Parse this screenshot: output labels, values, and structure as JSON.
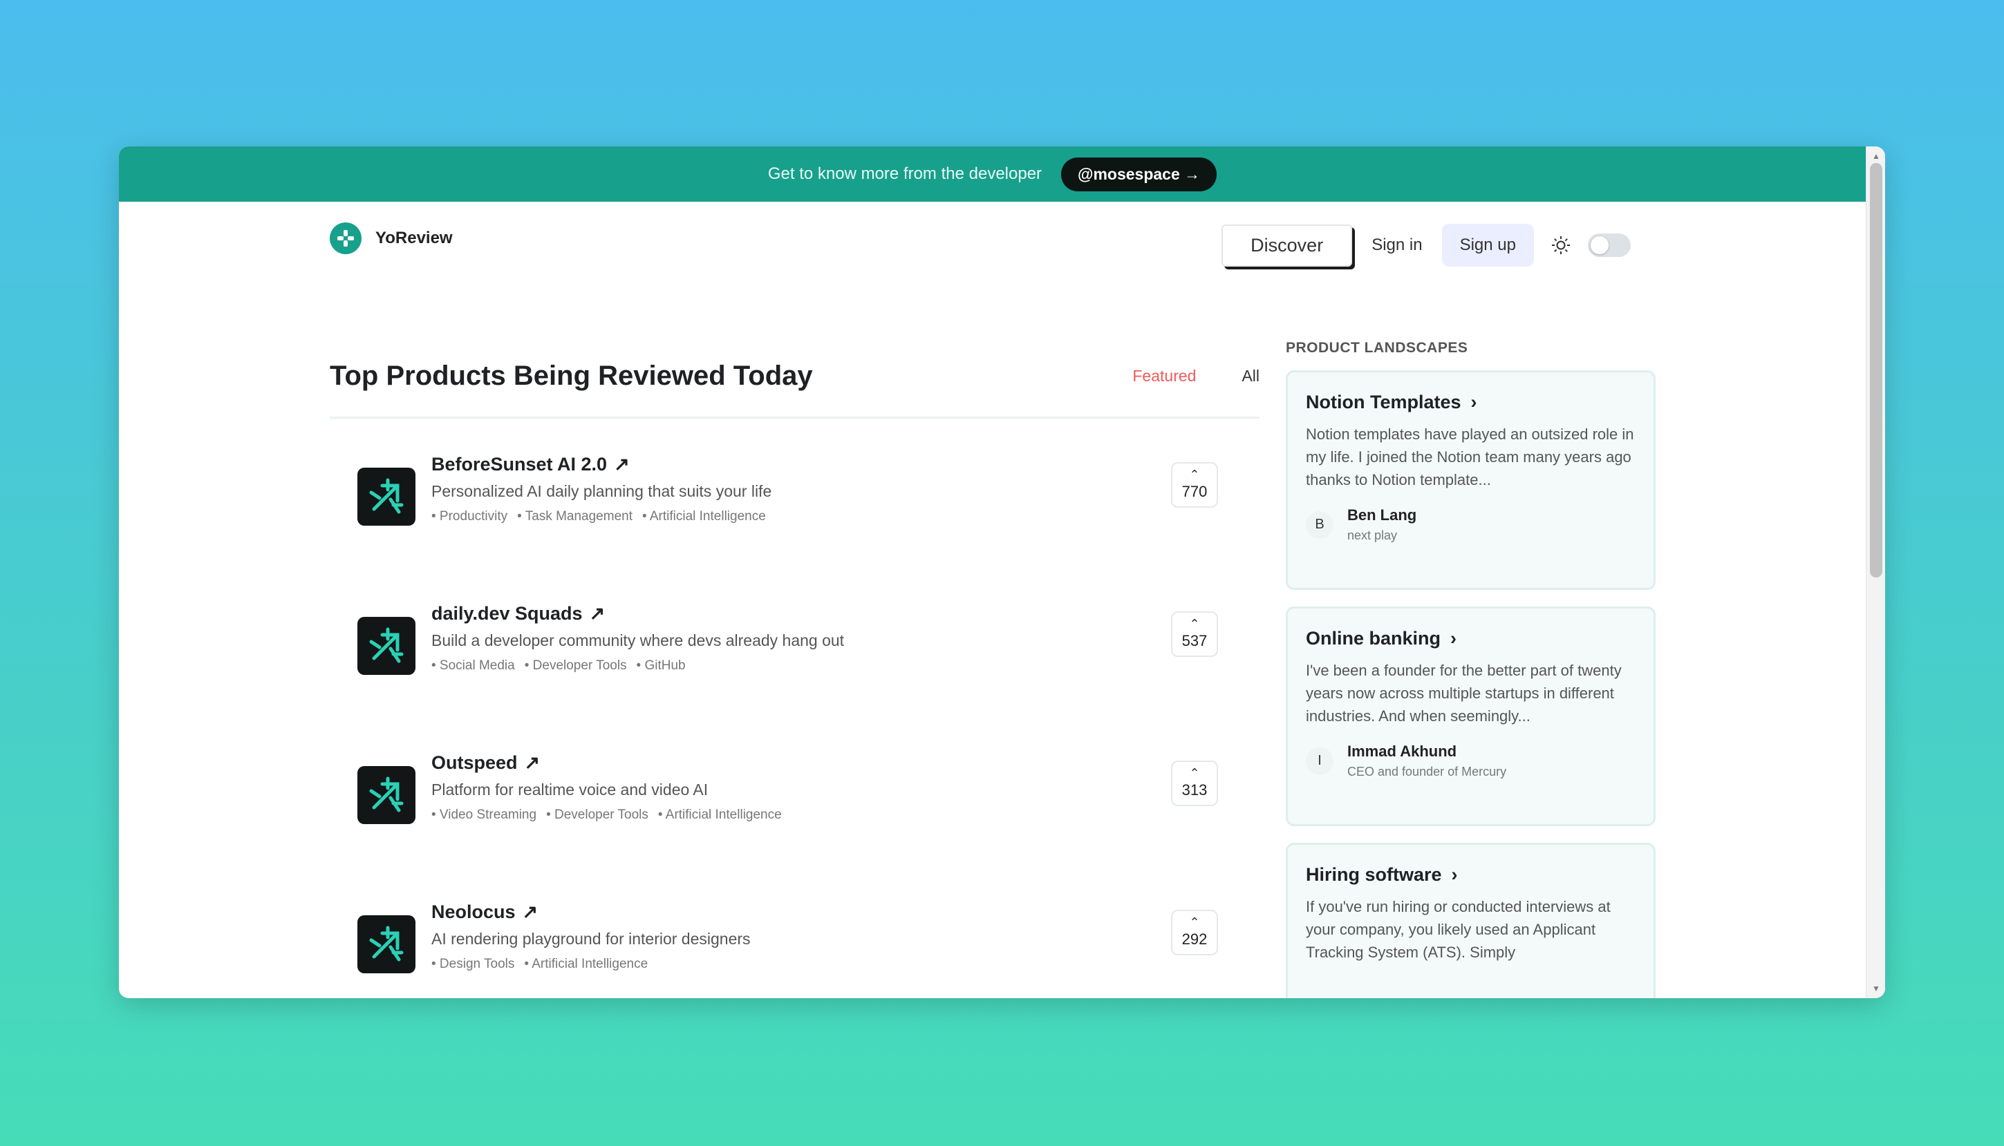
{
  "banner": {
    "text": "Get to know more from the developer",
    "pill_label": "@mosespace →"
  },
  "nav": {
    "brand": "YoReview",
    "discover_label": "Discover",
    "signin_label": "Sign in",
    "signup_label": "Sign up",
    "theme_toggle_on": false
  },
  "main": {
    "title": "Top Products Being Reviewed Today",
    "filters": [
      {
        "label": "Featured",
        "active": true
      },
      {
        "label": "All",
        "active": false
      }
    ],
    "products": [
      {
        "name": "BeforeSunset AI 2.0",
        "description": "Personalized AI daily planning that suits your life",
        "tags": [
          "• Productivity",
          "• Task Management",
          "• Artificial Intelligence"
        ],
        "votes": "770"
      },
      {
        "name": "daily.dev Squads",
        "description": "Build a developer community where devs already hang out",
        "tags": [
          "• Social Media",
          "• Developer Tools",
          "• GitHub"
        ],
        "votes": "537"
      },
      {
        "name": "Outspeed",
        "description": "Platform for realtime voice and video AI",
        "tags": [
          "• Video Streaming",
          "• Developer Tools",
          "• Artificial Intelligence"
        ],
        "votes": "313"
      },
      {
        "name": "Neolocus",
        "description": "AI rendering playground for interior designers",
        "tags": [
          "• Design Tools",
          "• Artificial Intelligence"
        ],
        "votes": "292"
      }
    ]
  },
  "sidebar": {
    "title": "PRODUCT LANDSCAPES",
    "landscapes": [
      {
        "title": "Notion Templates",
        "text": "Notion templates have played an outsized role in my life. I joined the Notion team many years ago thanks to Notion template...",
        "author_initial": "B",
        "author_name": "Ben Lang",
        "author_role": "next play"
      },
      {
        "title": "Online banking",
        "text": "I've been a founder for the better part of twenty years now across multiple startups in different industries. And when seemingly...",
        "author_initial": "I",
        "author_name": "Immad Akhund",
        "author_role": "CEO and founder of Mercury"
      },
      {
        "title": "Hiring software",
        "text": "If you've run hiring or conducted interviews at your company, you likely used an Applicant Tracking System (ATS). Simply",
        "author_initial": "",
        "author_name": "",
        "author_role": ""
      }
    ]
  },
  "colors": {
    "banner": "#17a08c",
    "accent_red": "#f05a5a",
    "card_bg": "#f3faf9"
  }
}
